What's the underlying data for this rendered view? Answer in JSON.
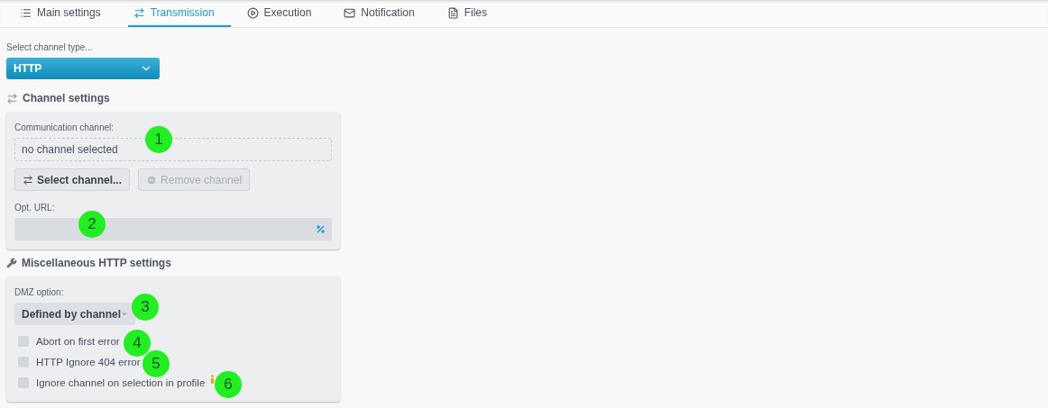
{
  "tabs": [
    {
      "label": "Main settings",
      "selected": false
    },
    {
      "label": "Transmission",
      "selected": true
    },
    {
      "label": "Execution",
      "selected": false
    },
    {
      "label": "Notification",
      "selected": false
    },
    {
      "label": "Files",
      "selected": false
    }
  ],
  "channel_type": {
    "label": "Select channel type...",
    "value": "HTTP"
  },
  "channel_settings": {
    "title": "Channel settings",
    "communication_label": "Communication channel:",
    "communication_value": "no channel selected",
    "select_button": "Select channel...",
    "remove_button": {
      "label": "Remove channel",
      "disabled": true
    },
    "url_label": "Opt. URL:"
  },
  "misc_settings": {
    "title": "Miscellaneous HTTP settings",
    "dmz_label": "DMZ option:",
    "dmz_value": "Defined by channel",
    "checkboxes": [
      {
        "label": "Abort on first error",
        "checked": false,
        "info": false
      },
      {
        "label": "HTTP Ignore 404 error",
        "checked": false,
        "info": false
      },
      {
        "label": "Ignore channel on selection in profile",
        "checked": false,
        "info": true
      }
    ]
  },
  "callouts": [
    "1",
    "2",
    "3",
    "4",
    "5",
    "6"
  ]
}
